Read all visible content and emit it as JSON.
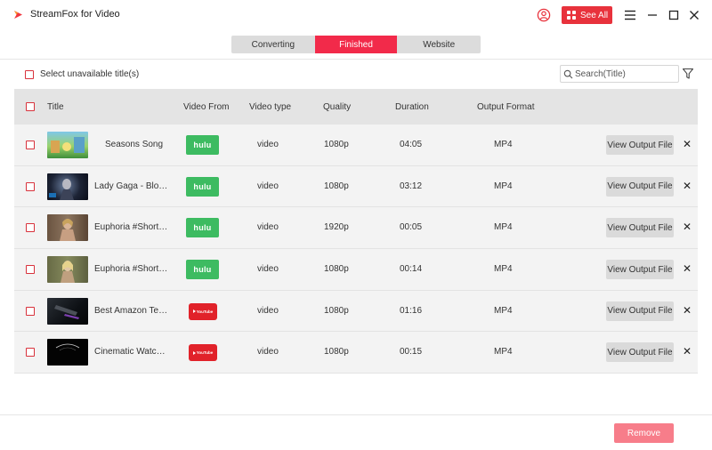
{
  "app": {
    "title": "StreamFox for Video",
    "see_all_label": "See All",
    "brand_color": "#f22a4a"
  },
  "tabs": [
    {
      "label": "Converting",
      "active": false
    },
    {
      "label": "Finished",
      "active": true
    },
    {
      "label": "Website",
      "active": false
    }
  ],
  "toolbar": {
    "select_unavailable_label": "Select unavailable title(s)",
    "search_placeholder": "Search(Title)"
  },
  "table": {
    "headers": {
      "title": "Title",
      "video_from": "Video From",
      "video_type": "Video type",
      "quality": "Quality",
      "duration": "Duration",
      "output_format": "Output Format"
    },
    "rows": [
      {
        "title": "Seasons Song",
        "source": "hulu",
        "source_label": "hulu",
        "type": "video",
        "quality": "1080p",
        "duration": "04:05",
        "format": "MP4",
        "action": "View Output File",
        "thumb": "cartoon-green"
      },
      {
        "title": "Lady Gaga - Bloo...",
        "source": "hulu",
        "source_label": "hulu",
        "type": "video",
        "quality": "1080p",
        "duration": "03:12",
        "format": "MP4",
        "action": "View Output File",
        "thumb": "dark-blue"
      },
      {
        "title": "Euphoria #Shorts ...",
        "source": "hulu",
        "source_label": "hulu",
        "type": "video",
        "quality": "1920p",
        "duration": "00:05",
        "format": "MP4",
        "action": "View Output File",
        "thumb": "warm-portrait"
      },
      {
        "title": "Euphoria #Shorts ...",
        "source": "hulu",
        "source_label": "hulu",
        "type": "video",
        "quality": "1080p",
        "duration": "00:14",
        "format": "MP4",
        "action": "View Output File",
        "thumb": "olive-portrait"
      },
      {
        "title": "Best Amazon Tec...",
        "source": "youtube",
        "source_label": "YouTube",
        "type": "video",
        "quality": "1080p",
        "duration": "01:16",
        "format": "MP4",
        "action": "View Output File",
        "thumb": "dark-tech"
      },
      {
        "title": "Cinematic Watch ...",
        "source": "youtube",
        "source_label": "YouTube",
        "type": "video",
        "quality": "1080p",
        "duration": "00:15",
        "format": "MP4",
        "action": "View Output File",
        "thumb": "black-watch"
      }
    ]
  },
  "footer": {
    "remove_label": "Remove"
  }
}
